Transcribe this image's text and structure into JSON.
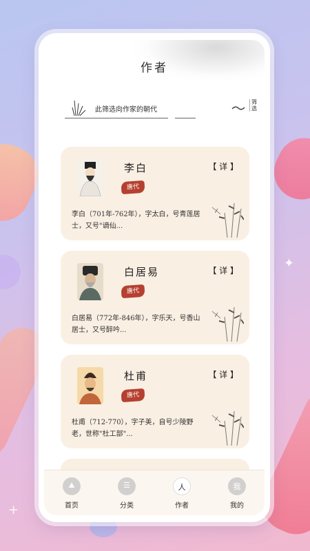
{
  "header": {
    "title": "作者"
  },
  "filter": {
    "placeholder_text": "此筛选向作家的朝代",
    "button_label": "筛选"
  },
  "authors": [
    {
      "name": "李白",
      "detail_label": "【 详 】",
      "dynasty": "唐代",
      "desc": "李白（701年-762年），字太白，号青莲居士，又号\"谪仙..."
    },
    {
      "name": "白居易",
      "detail_label": "【 详 】",
      "dynasty": "唐代",
      "desc": "白居易（772年-846年），字乐天，号香山居士，又号醉吟..."
    },
    {
      "name": "杜甫",
      "detail_label": "【 详 】",
      "dynasty": "唐代",
      "desc": "杜甫（712-770），字子美，自号少陵野老，世称\"杜工部\"..."
    }
  ],
  "tabbar": {
    "items": [
      {
        "label": "首页",
        "icon": "mountain-icon"
      },
      {
        "label": "分类",
        "icon": "category-icon"
      },
      {
        "label": "作者",
        "icon": "author-icon"
      },
      {
        "label": "我的",
        "icon": "profile-icon"
      }
    ]
  },
  "colors": {
    "card_bg": "#f9efe3",
    "badge": "#b64030",
    "accent_ink": "#333333"
  }
}
